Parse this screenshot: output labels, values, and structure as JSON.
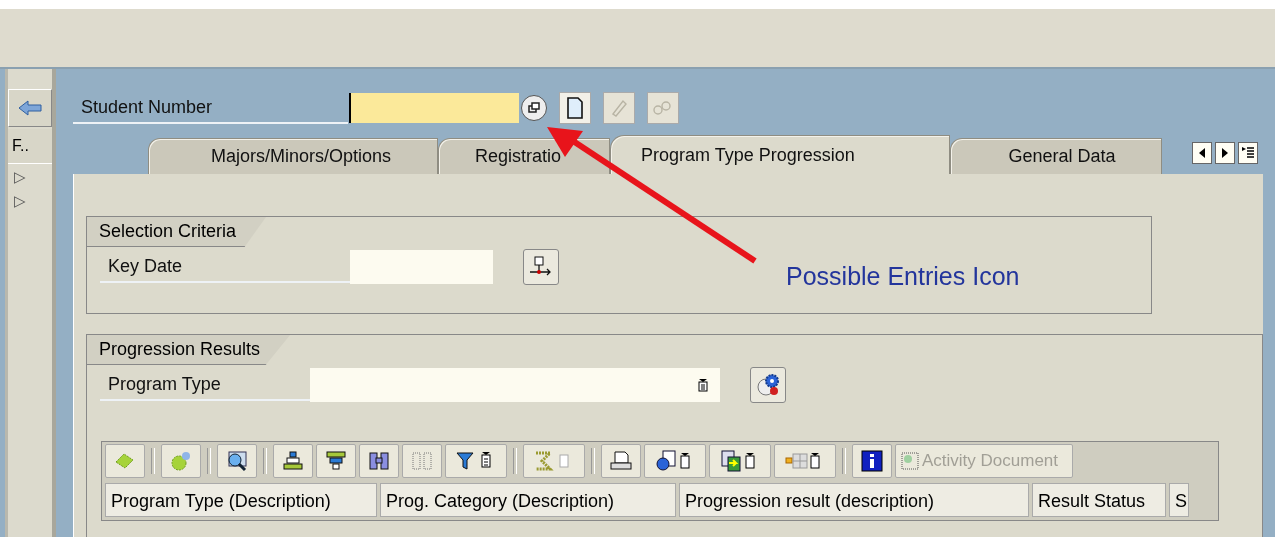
{
  "nav": {
    "items": [
      {
        "kind": "back"
      },
      {
        "kind": "text",
        "label": "F.."
      },
      {
        "kind": "expander",
        "label": "▷"
      },
      {
        "kind": "expander",
        "label": "▷"
      }
    ]
  },
  "student": {
    "label": "Student Number"
  },
  "tabs": [
    {
      "label": "Majors/Minors/Options",
      "selected": false
    },
    {
      "label": "Registratio",
      "selected": false
    },
    {
      "label": "Program Type Progression",
      "selected": true
    },
    {
      "label": "General Data",
      "selected": false
    }
  ],
  "selection_criteria": {
    "title": "Selection Criteria",
    "key_date": {
      "label": "Key Date"
    }
  },
  "progression_results": {
    "title": "Progression Results",
    "program_type": {
      "label": "Program Type"
    },
    "activity_button": {
      "label": "Activity Document",
      "disabled": true
    },
    "columns": [
      "Program Type (Description)",
      "Prog. Category (Description)",
      "Progression result (description)",
      "Result Status",
      "S"
    ]
  },
  "annotation": {
    "text": "Possible Entries Icon"
  }
}
